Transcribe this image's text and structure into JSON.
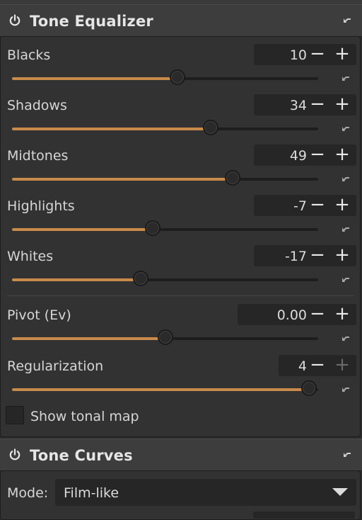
{
  "tone_equalizer": {
    "title": "Tone Equalizer",
    "sliders": [
      {
        "label": "Blacks",
        "value": "10",
        "level": 0.54
      },
      {
        "label": "Shadows",
        "value": "34",
        "level": 0.65
      },
      {
        "label": "Midtones",
        "value": "49",
        "level": 0.72
      },
      {
        "label": "Highlights",
        "value": "-7",
        "level": 0.46
      },
      {
        "label": "Whites",
        "value": "-17",
        "level": 0.42
      }
    ],
    "pivot": {
      "label": "Pivot (Ev)",
      "value": "0.00",
      "level": 0.5
    },
    "regularization": {
      "label": "Regularization",
      "value": "4",
      "level": 0.97
    },
    "show_tonal_map": {
      "label": "Show tonal map",
      "checked": false
    },
    "minus": "−",
    "plus": "+"
  },
  "tone_curves": {
    "title": "Tone Curves",
    "mode_label": "Mode:",
    "mode_value": "Film-like"
  },
  "colors": {
    "accent": "#c88a4a",
    "background": "#2b2b2b",
    "panel": "#323232",
    "header": "#3d3d3d"
  },
  "icons": [
    "power-icon",
    "reset-icon",
    "minus-icon",
    "plus-icon",
    "chevron-down-icon"
  ]
}
